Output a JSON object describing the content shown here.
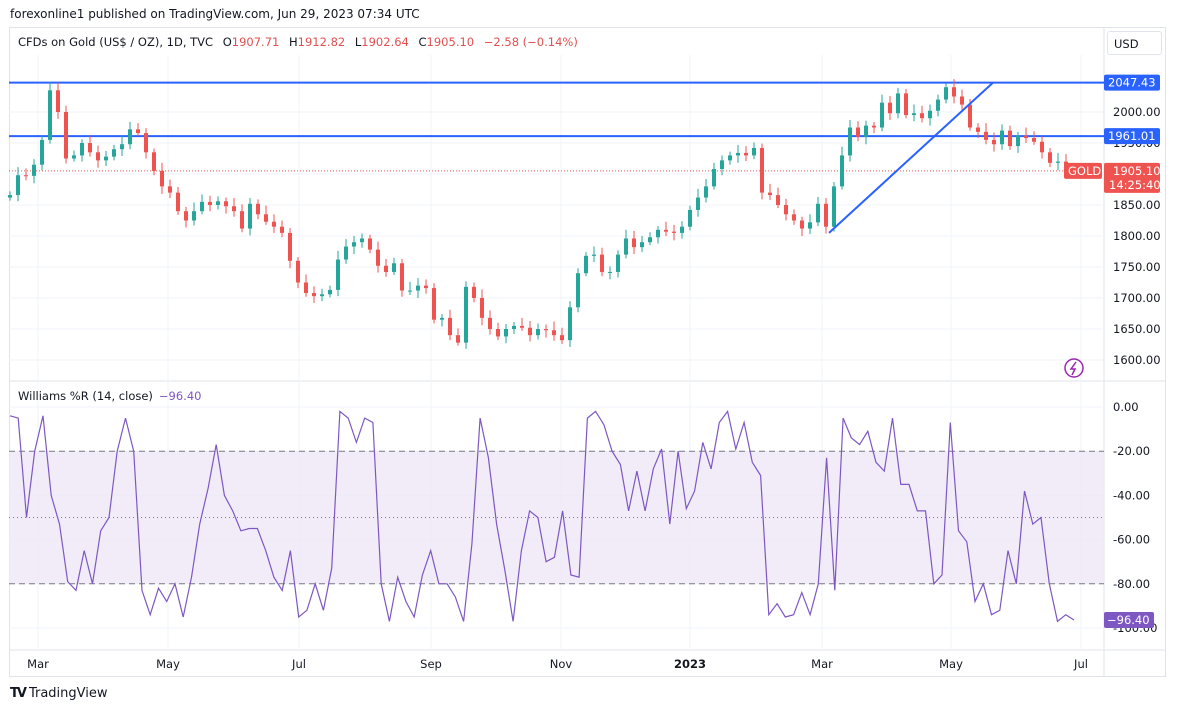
{
  "published": "forexonline1 published on TradingView.com, Jun 29, 2023 07:34 UTC",
  "legend": {
    "symbol": "CFDs on Gold (US$ / OZ), 1D, TVC",
    "open_label": "O",
    "open": "1907.71",
    "high_label": "H",
    "high": "1912.82",
    "low_label": "L",
    "low": "1902.64",
    "close_label": "C",
    "close": "1905.10",
    "change": "−2.58 (−0.14%)"
  },
  "currency": "USD",
  "branding": "TradingView",
  "colors": {
    "up": "#26a69a",
    "down": "#ef5350",
    "level": "#2962ff",
    "wr": "#7e57c2",
    "wr_band": "#ede7f6"
  },
  "chart_data": [
    {
      "type": "candlestick",
      "title": "CFDs on Gold (US$ / OZ), 1D, TVC",
      "x_ticks": [
        "Mar",
        "May",
        "Jul",
        "Sep",
        "Nov",
        "2023",
        "Mar",
        "May",
        "Jul"
      ],
      "y_ticks": [
        "1600.00",
        "1650.00",
        "1700.00",
        "1750.00",
        "1800.00",
        "1850.00",
        "1900.00",
        "1950.00",
        "2000.00"
      ],
      "ylim": [
        1585,
        2090
      ],
      "grid": true,
      "closes": [
        1866,
        1898,
        1897,
        1915,
        1955,
        2035,
        2000,
        1925,
        1930,
        1950,
        1935,
        1922,
        1928,
        1940,
        1948,
        1972,
        1966,
        1935,
        1905,
        1880,
        1870,
        1840,
        1825,
        1840,
        1855,
        1850,
        1856,
        1848,
        1840,
        1812,
        1852,
        1835,
        1823,
        1815,
        1805,
        1760,
        1725,
        1708,
        1703,
        1706,
        1713,
        1762,
        1783,
        1790,
        1796,
        1778,
        1752,
        1742,
        1756,
        1712,
        1712,
        1720,
        1716,
        1665,
        1668,
        1640,
        1628,
        1718,
        1700,
        1668,
        1650,
        1638,
        1650,
        1655,
        1652,
        1640,
        1650,
        1648,
        1640,
        1632,
        1685,
        1740,
        1768,
        1770,
        1742,
        1742,
        1770,
        1796,
        1782,
        1790,
        1798,
        1810,
        1807,
        1805,
        1815,
        1842,
        1862,
        1880,
        1908,
        1922,
        1930,
        1934,
        1930,
        1942,
        1870,
        1866,
        1850,
        1835,
        1825,
        1812,
        1822,
        1852,
        1815,
        1880,
        1930,
        1975,
        1960,
        1978,
        1975,
        2015,
        1998,
        2030,
        1995,
        1998,
        1990,
        2002,
        2020,
        2040,
        2025,
        2012,
        1975,
        1968,
        1955,
        1948,
        1970,
        1945,
        1962,
        1958,
        1952,
        1935,
        1918,
        1920,
        1905.1
      ],
      "horizontal_levels": [
        {
          "value": 2047.43,
          "label": "2047.43"
        },
        {
          "value": 1961.01,
          "label": "1961.01"
        }
      ],
      "trendline": {
        "from": {
          "date": "2023-03-08",
          "price": 1805
        },
        "to": {
          "date": "2023-05-19",
          "price": 2047.43
        }
      },
      "last_price": {
        "symbol_label": "GOLD",
        "value": "1905.10",
        "countdown": "14:25:40"
      }
    },
    {
      "type": "line",
      "title": "Williams %R (14, close)",
      "current": "−96.40",
      "y_ticks": [
        "0.00",
        "-20.00",
        "-40.00",
        "-60.00",
        "-80.00",
        "-100.00"
      ],
      "ylim": [
        -100,
        0
      ],
      "band": [
        -80,
        -20
      ],
      "midline": -50,
      "values": [
        -4,
        -5,
        -50,
        -20,
        -4,
        -40,
        -53,
        -79,
        -83,
        -65,
        -80,
        -56,
        -50,
        -20,
        -5,
        -20,
        -83,
        -94,
        -82,
        -88,
        -80,
        -95,
        -77,
        -53,
        -37,
        -17,
        -40,
        -47,
        -56,
        -55,
        -55,
        -65,
        -77,
        -83,
        -65,
        -95,
        -92,
        -80,
        -92,
        -73,
        -2,
        -5,
        -16,
        -5,
        -7,
        -80,
        -97,
        -77,
        -88,
        -95,
        -76,
        -65,
        -80,
        -80,
        -86,
        -97,
        -62,
        -5,
        -23,
        -53,
        -74,
        -97,
        -65,
        -47,
        -50,
        -70,
        -68,
        -47,
        -76,
        -77,
        -5,
        -2,
        -8,
        -20,
        -26,
        -47,
        -29,
        -47,
        -28,
        -19,
        -53,
        -20,
        -46,
        -38,
        -16,
        -28,
        -7,
        -2,
        -19,
        -7,
        -25,
        -31,
        -94,
        -89,
        -95,
        -94,
        -84,
        -94,
        -80,
        -23,
        -83,
        -5,
        -14,
        -17,
        -11,
        -25,
        -29,
        -5,
        -35,
        -35,
        -47,
        -47,
        -80,
        -76,
        -7,
        -56,
        -61,
        -88,
        -80,
        -94,
        -92,
        -65,
        -80,
        -38,
        -53,
        -50,
        -80,
        -97,
        -94,
        -96.4
      ]
    }
  ]
}
